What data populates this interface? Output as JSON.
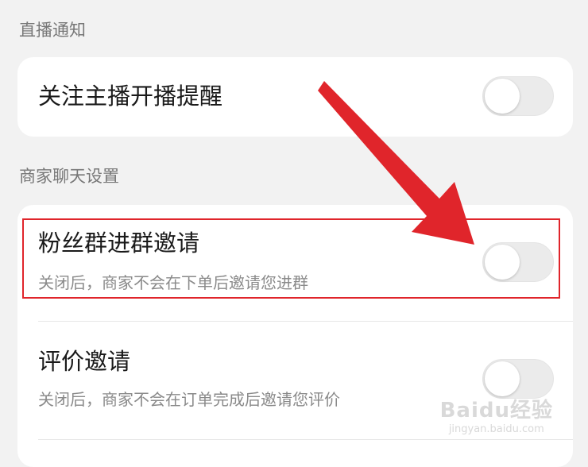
{
  "sections": [
    {
      "header": "直播通知",
      "items": [
        {
          "title": "关注主播开播提醒",
          "enabled": false
        }
      ]
    },
    {
      "header": "商家聊天设置",
      "items": [
        {
          "title": "粉丝群进群邀请",
          "description": "关闭后，商家不会在下单后邀请您进群",
          "enabled": false,
          "highlighted": true
        },
        {
          "title": "评价邀请",
          "description": "关闭后，商家不会在订单完成后邀请您评价",
          "enabled": false
        }
      ]
    }
  ],
  "annotation": {
    "highlight_color": "#e0252b",
    "arrow_color": "#e0252b"
  },
  "watermark": {
    "main": "Baidu经验",
    "url": "jingyan.baidu.com"
  },
  "colors": {
    "background": "#f2f2f2",
    "card": "#ffffff",
    "toggle_off": "#ebebeb"
  }
}
